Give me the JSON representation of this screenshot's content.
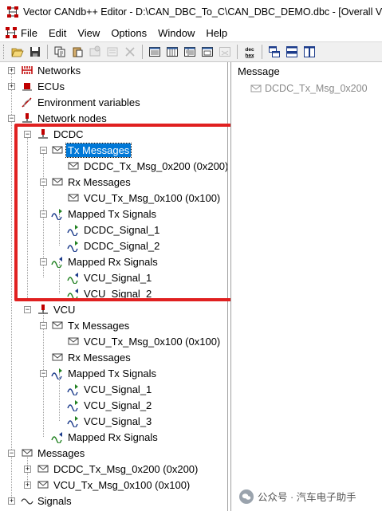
{
  "window": {
    "title": "Vector CANdb++ Editor - D:\\CAN_DBC_To_C\\CAN_DBC_DEMO.dbc - [Overall View]"
  },
  "menu": [
    "File",
    "Edit",
    "View",
    "Options",
    "Window",
    "Help"
  ],
  "toolbar": {
    "buttons": [
      "open-icon",
      "save-icon",
      "copy-icon",
      "paste-icon",
      "properties-icon",
      "disabled-icon",
      "delete-icon",
      "view-list-icon",
      "view-table-icon",
      "view-detail-icon",
      "view-matrix-icon",
      "view-disabled-icon",
      "dec-hex-icon",
      "cascade-icon",
      "tile-horizontal-icon",
      "tile-vertical-icon"
    ],
    "dechex_top": "dec",
    "dechex_bottom": "hex"
  },
  "tree": {
    "networks": "Networks",
    "ecus": "ECUs",
    "env_vars": "Environment variables",
    "network_nodes": "Network nodes",
    "dcdc": {
      "label": "DCDC",
      "tx_messages": "Tx Messages",
      "tx_msg": "DCDC_Tx_Msg_0x200 (0x200)",
      "rx_messages": "Rx Messages",
      "rx_msg": "VCU_Tx_Msg_0x100 (0x100)",
      "mapped_tx": "Mapped Tx Signals",
      "tx_sig1": "DCDC_Signal_1",
      "tx_sig2": "DCDC_Signal_2",
      "mapped_rx": "Mapped Rx Signals",
      "rx_sig1": "VCU_Signal_1",
      "rx_sig2": "VCU_Signal_2"
    },
    "vcu": {
      "label": "VCU",
      "tx_messages": "Tx Messages",
      "tx_msg": "VCU_Tx_Msg_0x100 (0x100)",
      "rx_messages": "Rx Messages",
      "mapped_tx": "Mapped Tx Signals",
      "tx_sig1": "VCU_Signal_1",
      "tx_sig2": "VCU_Signal_2",
      "tx_sig3": "VCU_Signal_3",
      "mapped_rx": "Mapped Rx Signals"
    },
    "messages": "Messages",
    "msg1": "DCDC_Tx_Msg_0x200 (0x200)",
    "msg2": "VCU_Tx_Msg_0x100 (0x100)",
    "signals": "Signals",
    "expand_plus": "+",
    "collapse_minus": "−"
  },
  "right_panel": {
    "header": "Message",
    "item": "DCDC_Tx_Msg_0x200"
  },
  "watermark": {
    "text": "公众号 · 汽车电子助手"
  },
  "colors": {
    "selection": "#0078d7",
    "highlight_box": "#e02020",
    "ecu_red": "#c00000"
  }
}
